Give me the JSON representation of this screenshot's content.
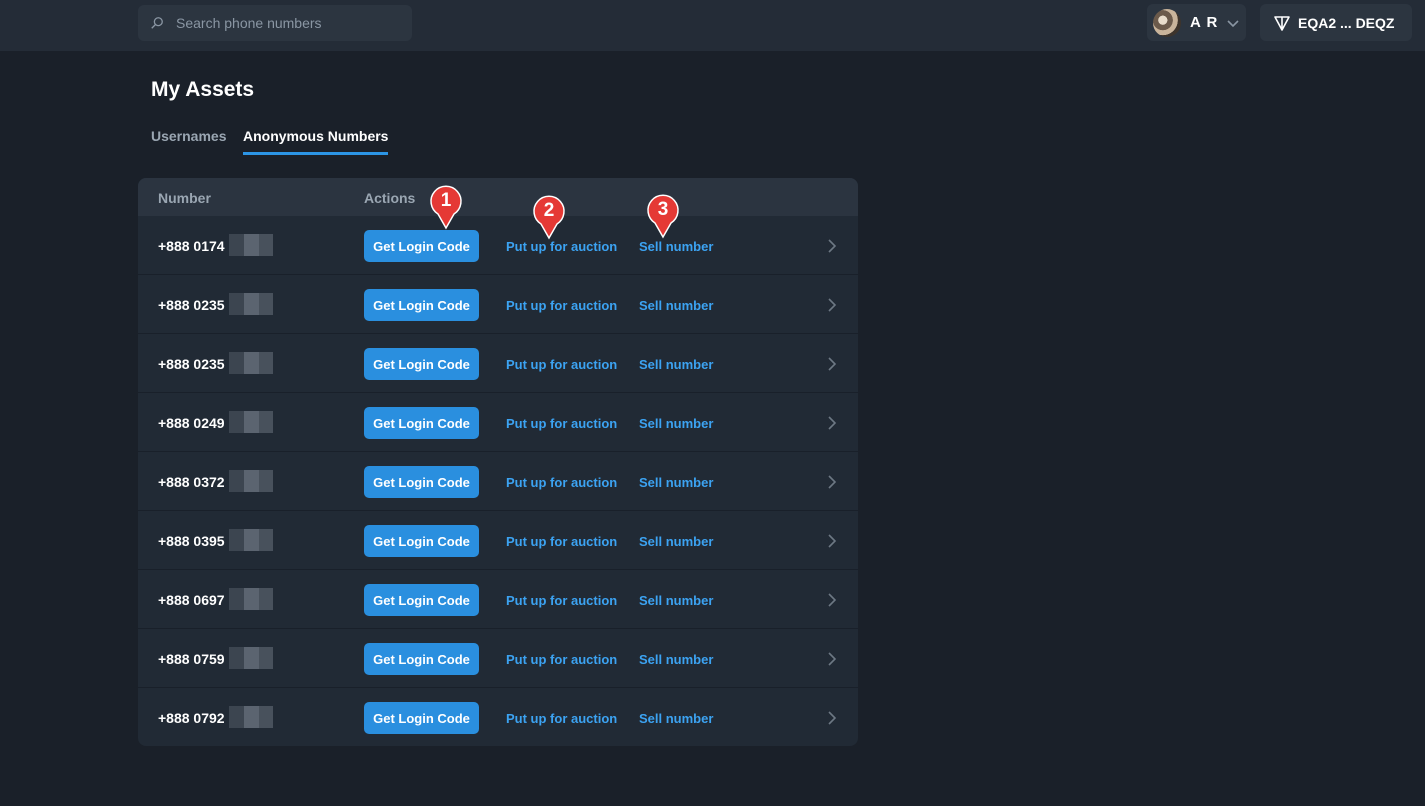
{
  "topbar": {
    "search_placeholder": "Search phone numbers",
    "user_initials": "A R",
    "wallet_label": "EQA2 ... DEQZ"
  },
  "page": {
    "title": "My Assets",
    "tabs": [
      {
        "label": "Usernames",
        "active": false
      },
      {
        "label": "Anonymous Numbers",
        "active": true
      }
    ]
  },
  "table": {
    "headers": {
      "number": "Number",
      "actions": "Actions"
    },
    "rows": [
      {
        "number": "+888 0174"
      },
      {
        "number": "+888 0235"
      },
      {
        "number": "+888 0235"
      },
      {
        "number": "+888 0249"
      },
      {
        "number": "+888 0372"
      },
      {
        "number": "+888 0395"
      },
      {
        "number": "+888 0697"
      },
      {
        "number": "+888 0759"
      },
      {
        "number": "+888 0792"
      }
    ],
    "action_labels": {
      "login": "Get Login Code",
      "auction": "Put up for auction",
      "sell": "Sell number"
    }
  },
  "markers": [
    "1",
    "2",
    "3"
  ],
  "colors": {
    "accent": "#2a8fdf",
    "link": "#3ca3f2",
    "marker": "#e53935",
    "background": "#1a2029"
  }
}
